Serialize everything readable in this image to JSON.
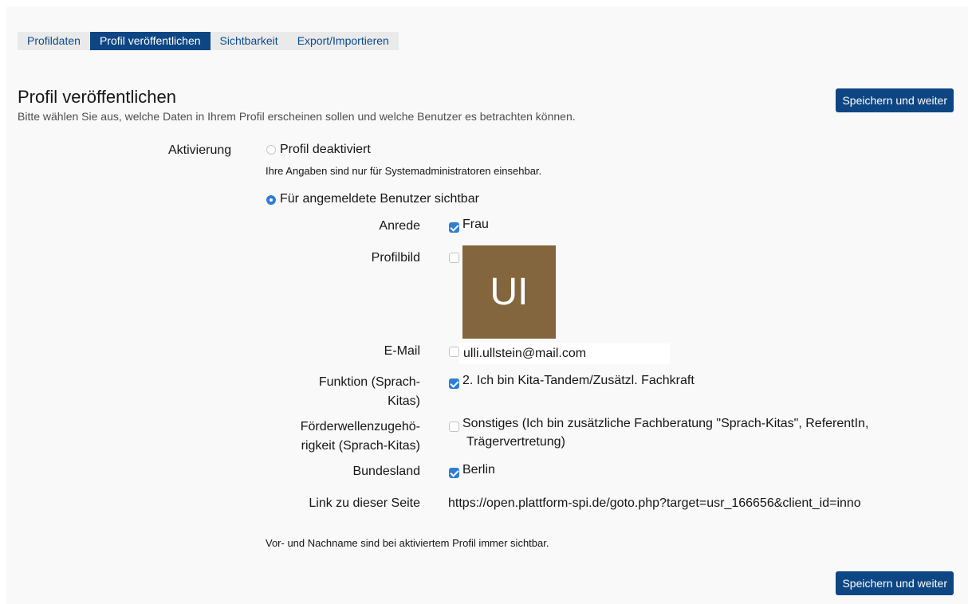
{
  "tabs": [
    {
      "label": "Profildaten",
      "active": false
    },
    {
      "label": "Profil veröffentlichen",
      "active": true
    },
    {
      "label": "Sichtbarkeit",
      "active": false
    },
    {
      "label": "Export/Importieren",
      "active": false
    }
  ],
  "header": {
    "title": "Profil veröffentlichen",
    "description": "Bitte wählen Sie aus, welche Daten in Ihrem Profil erscheinen sollen und welche Benutzer es betrachten können.",
    "save_label": "Speichern und weiter"
  },
  "activation": {
    "label": "Aktivierung",
    "option_disabled": {
      "label": "Profil deaktiviert",
      "selected": false,
      "info": "Ihre Angaben sind nur für Systemadministratoren einsehbar."
    },
    "option_logged_in": {
      "label": "Für angemeldete Benutzer sichtbar",
      "selected": true
    }
  },
  "fields": {
    "anrede": {
      "label": "Anrede",
      "checked": true,
      "value": "Frau"
    },
    "profilbild": {
      "label": "Profilbild",
      "checked": false,
      "avatar_initials": "UI",
      "avatar_color": "#83663d"
    },
    "email": {
      "label": "E-Mail",
      "checked": false,
      "value": "ulli.ullstein@mail.com"
    },
    "funktion": {
      "label_line1": "Funktion (Sprach-",
      "label_line2": "Kitas)",
      "checked": true,
      "value": "2. Ich bin Kita-Tandem/Zusätzl. Fachkraft"
    },
    "foerderwelle": {
      "label_line1": "Förderwellenzugehö-",
      "label_line2": "rigkeit (Sprach-Kitas)",
      "checked": false,
      "value_line1": "Sonstiges (Ich bin zusätzliche Fachberatung \"Sprach-Kitas\", ReferentIn,",
      "value_line2": "Trägervertretung)"
    },
    "bundesland": {
      "label": "Bundesland",
      "checked": true,
      "value": "Berlin"
    },
    "link": {
      "label": "Link zu dieser Seite",
      "value": "https://open.plattform-spi.de/goto.php?target=usr_166656&client_id=inno"
    }
  },
  "footer_note": "Vor- und Nachname sind bei aktiviertem Profil immer sichtbar.",
  "footer": {
    "save_label": "Speichern und weiter"
  },
  "colors": {
    "primary": "#0e4684",
    "accent": "#2f7dd6",
    "tab_bg": "#eaeaea"
  }
}
